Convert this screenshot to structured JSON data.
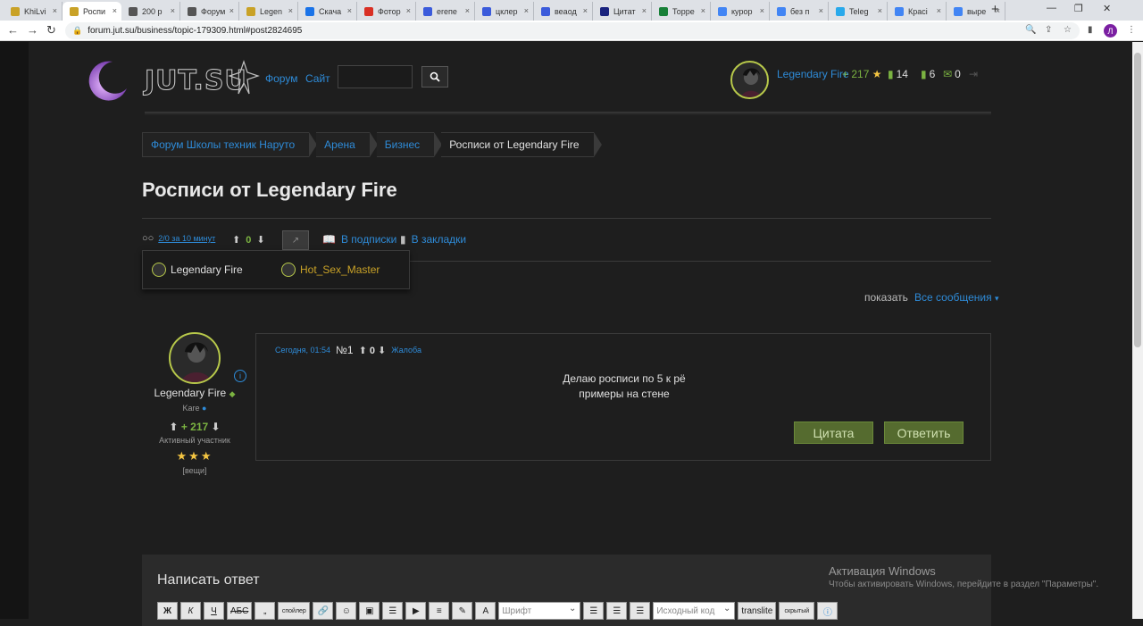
{
  "browser": {
    "tabs": [
      {
        "title": "KhiLvi",
        "color": "#c9a227",
        "active": false
      },
      {
        "title": "Роспи",
        "color": "#c9a227",
        "active": true
      },
      {
        "title": "200 р",
        "color": "#555555",
        "active": false
      },
      {
        "title": "Форум",
        "color": "#555555",
        "active": false
      },
      {
        "title": "Legen",
        "color": "#c9a227",
        "active": false
      },
      {
        "title": "Скача",
        "color": "#1a73e8",
        "active": false
      },
      {
        "title": "Фотор",
        "color": "#d93025",
        "active": false
      },
      {
        "title": "ereпe",
        "color": "#3b5bdb",
        "active": false
      },
      {
        "title": "цклер",
        "color": "#3b5bdb",
        "active": false
      },
      {
        "title": "веаод",
        "color": "#3b5bdb",
        "active": false
      },
      {
        "title": "Цитат",
        "color": "#1a237e",
        "active": false
      },
      {
        "title": "Торре",
        "color": "#188038",
        "active": false
      },
      {
        "title": "курор",
        "color": "#4285f4",
        "active": false
      },
      {
        "title": "без п",
        "color": "#4285f4",
        "active": false
      },
      {
        "title": "Teleg",
        "color": "#29a9eb",
        "active": false
      },
      {
        "title": "Красі",
        "color": "#4285f4",
        "active": false
      },
      {
        "title": "выре",
        "color": "#4285f4",
        "active": false
      }
    ],
    "url": "forum.jut.su/business/topic-179309.html#post2824695",
    "profile_initial": "Л"
  },
  "site": {
    "logo_text": "JUT.SU",
    "nav": {
      "forum": "Форум",
      "site": "Сайт"
    },
    "search_placeholder": ""
  },
  "user": {
    "name": "Legendary Fire",
    "rep": "+ 217",
    "notebooks": "14",
    "bookmarks": "6",
    "messages": "0"
  },
  "breadcrumbs": [
    "Форум Школы техник Наруто",
    "Арена",
    "Бизнес",
    "Росписи от Legendary Fire"
  ],
  "topic": {
    "title": "Росписи от Legendary Fire",
    "views": "2/0 за 10 минут",
    "rating": "0",
    "subscribe": "В подписки",
    "bookmark": "В закладки",
    "viewers": [
      {
        "name": "Legendary Fire",
        "color": "#e0e0e0"
      },
      {
        "name": "Hot_Sex_Master",
        "color": "#c9a227"
      }
    ],
    "show_label": "показать",
    "show_value": "Все сообщения"
  },
  "post": {
    "author": {
      "name": "Legendary Fire",
      "rank": "Kare",
      "rep": "+ 217",
      "status": "Активный участник",
      "stars": "★★★",
      "items": "[вещи]"
    },
    "time": "Сегодня, 01:54",
    "number": "№1",
    "rating": "0",
    "report": "Жалоба",
    "lines": [
      "Делаю росписи по 5 к рё",
      "примеры на стене"
    ],
    "quote_btn": "Цитата",
    "reply_btn": "Ответить"
  },
  "reply": {
    "title": "Написать ответ",
    "toolbar": {
      "bold": "Ж",
      "italic": "К",
      "underline": "Ч",
      "strike": "АБС",
      "quote": "„",
      "spoiler": "спойлер",
      "font": "Шрифт",
      "source": "Исходный код",
      "translit": "translite",
      "hidden": "скрытый"
    }
  },
  "windows": {
    "line1": "Активация Windows",
    "line2": "Чтобы активировать Windows, перейдите в раздел \"Параметры\"."
  }
}
